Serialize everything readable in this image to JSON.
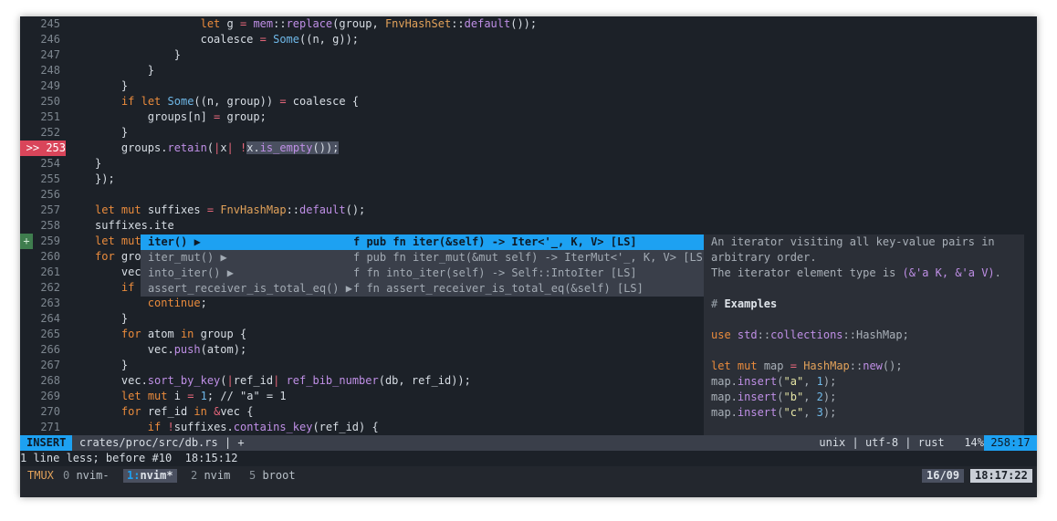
{
  "editor": {
    "lines": [
      {
        "n": "245",
        "parts": [
          [
            "                ",
            ""
          ],
          [
            "let",
            "kw"
          ],
          [
            " g ",
            ""
          ],
          [
            "=",
            "op"
          ],
          [
            " ",
            ""
          ],
          [
            "mem",
            "fn"
          ],
          [
            "::",
            ""
          ],
          [
            "replace",
            "fn"
          ],
          [
            "(group, ",
            ""
          ],
          [
            "FnvHashSet",
            "ty"
          ],
          [
            "::",
            ""
          ],
          [
            "default",
            "fn"
          ],
          [
            "());",
            ""
          ]
        ]
      },
      {
        "n": "246",
        "parts": [
          [
            "                coalesce ",
            ""
          ],
          [
            "=",
            "op"
          ],
          [
            " ",
            ""
          ],
          [
            "Some",
            "num"
          ],
          [
            "((n, g));",
            ""
          ]
        ]
      },
      {
        "n": "247",
        "parts": [
          [
            "            }",
            ""
          ]
        ]
      },
      {
        "n": "248",
        "parts": [
          [
            "        }",
            ""
          ]
        ]
      },
      {
        "n": "249",
        "parts": [
          [
            "    }",
            ""
          ]
        ]
      },
      {
        "n": "250",
        "parts": [
          [
            "    ",
            ""
          ],
          [
            "if",
            "kw"
          ],
          [
            " ",
            ""
          ],
          [
            "let",
            "kw"
          ],
          [
            " ",
            ""
          ],
          [
            "Some",
            "num"
          ],
          [
            "((n, group)) ",
            ""
          ],
          [
            "=",
            "op"
          ],
          [
            " coalesce {",
            ""
          ]
        ]
      },
      {
        "n": "251",
        "parts": [
          [
            "        groups[n] ",
            ""
          ],
          [
            "=",
            "op"
          ],
          [
            " group;",
            ""
          ]
        ]
      },
      {
        "n": "252",
        "parts": [
          [
            "    }",
            ""
          ]
        ]
      },
      {
        "n": ">> 253",
        "cur": true,
        "parts": [
          [
            "    groups.",
            ""
          ],
          [
            "retain",
            "fn"
          ],
          [
            "(",
            ""
          ],
          [
            "|",
            "op"
          ],
          [
            "x",
            ""
          ],
          [
            "|",
            "op"
          ],
          [
            " ",
            ""
          ],
          [
            "!",
            "op"
          ],
          [
            "x.",
            ""
          ],
          [
            "is_empty",
            "fn"
          ],
          [
            "());",
            ""
          ]
        ]
      },
      {
        "n": "254",
        "parts": [
          [
            "}",
            ""
          ]
        ]
      },
      {
        "n": "255",
        "parts": [
          [
            "});",
            ""
          ]
        ]
      },
      {
        "n": "256",
        "parts": [
          [
            "",
            ""
          ]
        ]
      },
      {
        "n": "257",
        "parts": [
          [
            "let",
            "kw"
          ],
          [
            " ",
            ""
          ],
          [
            "mut",
            "kw"
          ],
          [
            " suffixes ",
            ""
          ],
          [
            "=",
            "op"
          ],
          [
            " ",
            ""
          ],
          [
            "FnvHashMap",
            "ty"
          ],
          [
            "::",
            ""
          ],
          [
            "default",
            "fn"
          ],
          [
            "();",
            ""
          ]
        ]
      },
      {
        "n": "258",
        "parts": [
          [
            "suffixes.ite",
            ""
          ]
        ]
      },
      {
        "n": "259",
        "sign": "+",
        "parts": [
          [
            "let",
            "kw"
          ],
          [
            " ",
            ""
          ],
          [
            "mut",
            "kw"
          ]
        ]
      },
      {
        "n": "260",
        "parts": [
          [
            "for",
            "kw"
          ],
          [
            " grou",
            ""
          ]
        ]
      },
      {
        "n": "261",
        "parts": [
          [
            "    vec.",
            ""
          ]
        ]
      },
      {
        "n": "262",
        "parts": [
          [
            "    ",
            ""
          ],
          [
            "if",
            "kw"
          ],
          [
            " g",
            ""
          ]
        ]
      },
      {
        "n": "263",
        "parts": [
          [
            "        ",
            ""
          ],
          [
            "continue",
            "kw"
          ],
          [
            ";",
            ""
          ]
        ]
      },
      {
        "n": "264",
        "parts": [
          [
            "    }",
            ""
          ]
        ]
      },
      {
        "n": "265",
        "parts": [
          [
            "    ",
            ""
          ],
          [
            "for",
            "kw"
          ],
          [
            " atom ",
            ""
          ],
          [
            "in",
            "kw"
          ],
          [
            " group {",
            ""
          ]
        ]
      },
      {
        "n": "266",
        "parts": [
          [
            "        vec.",
            ""
          ],
          [
            "push",
            "fn"
          ],
          [
            "(atom);",
            ""
          ]
        ]
      },
      {
        "n": "267",
        "parts": [
          [
            "    }",
            ""
          ]
        ]
      },
      {
        "n": "268",
        "parts": [
          [
            "    vec.",
            ""
          ],
          [
            "sort_by_key",
            "fn"
          ],
          [
            "(",
            ""
          ],
          [
            "|",
            "op"
          ],
          [
            "ref_id",
            ""
          ],
          [
            "|",
            "op"
          ],
          [
            " ",
            ""
          ],
          [
            "ref_bib_number",
            "fn"
          ],
          [
            "(db, ref_id));",
            ""
          ]
        ]
      },
      {
        "n": "269",
        "parts": [
          [
            "    ",
            ""
          ],
          [
            "let",
            "kw"
          ],
          [
            " ",
            ""
          ],
          [
            "mut",
            "kw"
          ],
          [
            " i ",
            ""
          ],
          [
            "=",
            "op"
          ],
          [
            " ",
            ""
          ],
          [
            "1",
            "num"
          ],
          [
            "; // \"a\" = 1",
            ""
          ]
        ]
      },
      {
        "n": "270",
        "parts": [
          [
            "    ",
            ""
          ],
          [
            "for",
            "kw"
          ],
          [
            " ref_id ",
            ""
          ],
          [
            "in",
            "kw"
          ],
          [
            " ",
            ""
          ],
          [
            "&",
            "op"
          ],
          [
            "vec {",
            ""
          ]
        ]
      },
      {
        "n": "271",
        "parts": [
          [
            "        ",
            ""
          ],
          [
            "if",
            "kw"
          ],
          [
            " ",
            ""
          ],
          [
            "!",
            "op"
          ],
          [
            "suffixes.",
            ""
          ],
          [
            "contains_key",
            "fn"
          ],
          [
            "(ref_id) {",
            ""
          ]
        ]
      }
    ]
  },
  "completion": {
    "items": [
      {
        "word": "iter() ▶",
        "menu": "f pub fn iter(&self) -> Iter<'_, K, V> [LS]",
        "selected": true
      },
      {
        "word": "iter_mut() ▶",
        "menu": "f pub fn iter_mut(&mut self) -> IterMut<'_, K, V> [LS]"
      },
      {
        "word": "into_iter() ▶",
        "menu": "f fn into_iter(self) -> Self::IntoIter [LS]"
      },
      {
        "word": "assert_receiver_is_total_eq() ▶",
        "menu": "f fn assert_receiver_is_total_eq(&self) [LS]"
      }
    ]
  },
  "doc": {
    "lines": [
      [
        [
          "An iterator visiting all key-value pairs in",
          ""
        ]
      ],
      [
        [
          "arbitrary order.",
          ""
        ]
      ],
      [
        [
          "The iterator element type is ",
          ""
        ],
        [
          "(&'a K, &'a V)",
          "fn"
        ],
        [
          ".",
          ""
        ]
      ],
      [
        [
          "",
          ""
        ]
      ],
      [
        [
          "# ",
          "cm"
        ],
        [
          "Examples",
          "bold"
        ]
      ],
      [
        [
          "",
          ""
        ]
      ],
      [
        [
          "use",
          "kw"
        ],
        [
          " ",
          ""
        ],
        [
          "std",
          "fn"
        ],
        [
          "::",
          ""
        ],
        [
          "collections",
          "fn"
        ],
        [
          "::HashMap;",
          ""
        ]
      ],
      [
        [
          "",
          ""
        ]
      ],
      [
        [
          "let",
          "kw"
        ],
        [
          " ",
          ""
        ],
        [
          "mut",
          "kw"
        ],
        [
          " map ",
          ""
        ],
        [
          "=",
          "op"
        ],
        [
          " ",
          ""
        ],
        [
          "HashMap",
          "ty"
        ],
        [
          "::",
          ""
        ],
        [
          "new",
          "fn"
        ],
        [
          "();",
          ""
        ]
      ],
      [
        [
          "map.",
          ""
        ],
        [
          "insert",
          "fn"
        ],
        [
          "(",
          ""
        ],
        [
          "\"a\"",
          "str"
        ],
        [
          ", ",
          ""
        ],
        [
          "1",
          "num"
        ],
        [
          ");",
          ""
        ]
      ],
      [
        [
          "map.",
          ""
        ],
        [
          "insert",
          "fn"
        ],
        [
          "(",
          ""
        ],
        [
          "\"b\"",
          "str"
        ],
        [
          ", ",
          ""
        ],
        [
          "2",
          "num"
        ],
        [
          ");",
          ""
        ]
      ],
      [
        [
          "map.",
          ""
        ],
        [
          "insert",
          "fn"
        ],
        [
          "(",
          ""
        ],
        [
          "\"c\"",
          "str"
        ],
        [
          ", ",
          ""
        ],
        [
          "3",
          "num"
        ],
        [
          ");",
          ""
        ]
      ]
    ]
  },
  "status": {
    "mode": "INSERT",
    "file": "crates/proc/src/db.rs | +",
    "right": "unix | utf-8 | rust   14%",
    "position": "258:17"
  },
  "cmdline": "1 line less; before #10  18:15:12",
  "tmux": {
    "label": "TMUX",
    "windows": [
      {
        "num": "0",
        "name": " nvim-",
        "active": false
      },
      {
        "num": "1:",
        "name": "nvim*",
        "active": true
      },
      {
        "num": "2",
        "name": " nvim",
        "active": false
      },
      {
        "num": "5",
        "name": " broot",
        "active": false
      }
    ],
    "date": "16/09",
    "time": "18:17:22"
  }
}
